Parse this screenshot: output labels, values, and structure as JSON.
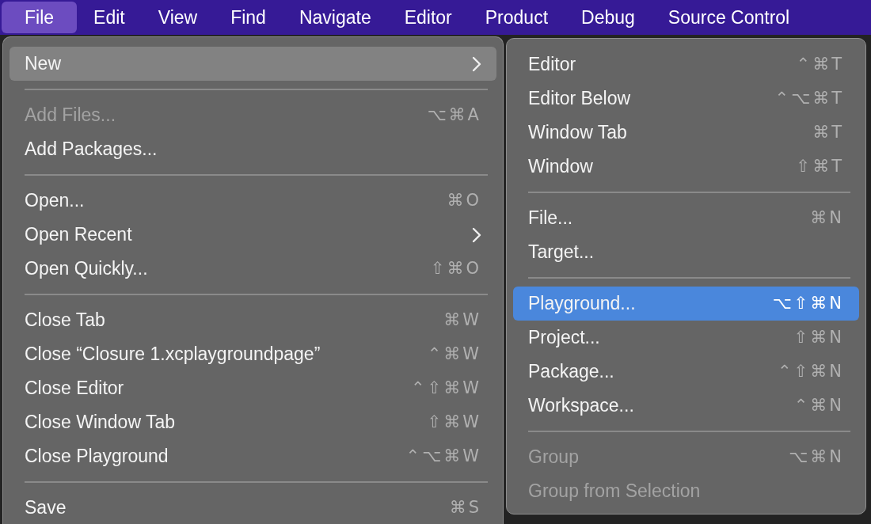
{
  "menu_bar": [
    {
      "label": "File",
      "selected": true
    },
    {
      "label": "Edit",
      "selected": false
    },
    {
      "label": "View",
      "selected": false
    },
    {
      "label": "Find",
      "selected": false
    },
    {
      "label": "Navigate",
      "selected": false
    },
    {
      "label": "Editor",
      "selected": false
    },
    {
      "label": "Product",
      "selected": false
    },
    {
      "label": "Debug",
      "selected": false
    },
    {
      "label": "Source Control",
      "selected": false
    }
  ],
  "file_menu": [
    {
      "kind": "item",
      "label": "New",
      "submenu": true,
      "selected": true,
      "disabled": false
    },
    {
      "kind": "separator"
    },
    {
      "kind": "item",
      "label": "Add Files...",
      "shortcut": "⌥⌘A",
      "selected": false,
      "disabled": true
    },
    {
      "kind": "item",
      "label": "Add Packages...",
      "selected": false,
      "disabled": false
    },
    {
      "kind": "separator"
    },
    {
      "kind": "item",
      "label": "Open...",
      "shortcut": "⌘O",
      "selected": false,
      "disabled": false
    },
    {
      "kind": "item",
      "label": "Open Recent",
      "submenu": true,
      "selected": false,
      "disabled": false
    },
    {
      "kind": "item",
      "label": "Open Quickly...",
      "shortcut": "⇧⌘O",
      "selected": false,
      "disabled": false
    },
    {
      "kind": "separator"
    },
    {
      "kind": "item",
      "label": "Close Tab",
      "shortcut": "⌘W",
      "selected": false,
      "disabled": false
    },
    {
      "kind": "item",
      "label": "Close “Closure 1.xcplaygroundpage”",
      "shortcut": "⌃⌘W",
      "selected": false,
      "disabled": false
    },
    {
      "kind": "item",
      "label": "Close Editor",
      "shortcut": "⌃⇧⌘W",
      "selected": false,
      "disabled": false
    },
    {
      "kind": "item",
      "label": "Close Window Tab",
      "shortcut": "⇧⌘W",
      "selected": false,
      "disabled": false
    },
    {
      "kind": "item",
      "label": "Close Playground",
      "shortcut": "⌃⌥⌘W",
      "selected": false,
      "disabled": false
    },
    {
      "kind": "separator"
    },
    {
      "kind": "item",
      "label": "Save",
      "shortcut": "⌘S",
      "selected": false,
      "disabled": false
    }
  ],
  "new_submenu": [
    {
      "kind": "item",
      "label": "Editor",
      "shortcut": "⌃⌘T",
      "selected": false,
      "disabled": false
    },
    {
      "kind": "item",
      "label": "Editor Below",
      "shortcut": "⌃⌥⌘T",
      "selected": false,
      "disabled": false
    },
    {
      "kind": "item",
      "label": "Window Tab",
      "shortcut": "⌘T",
      "selected": false,
      "disabled": false
    },
    {
      "kind": "item",
      "label": "Window",
      "shortcut": "⇧⌘T",
      "selected": false,
      "disabled": false
    },
    {
      "kind": "separator"
    },
    {
      "kind": "item",
      "label": "File...",
      "shortcut": "⌘N",
      "selected": false,
      "disabled": false
    },
    {
      "kind": "item",
      "label": "Target...",
      "selected": false,
      "disabled": false
    },
    {
      "kind": "separator"
    },
    {
      "kind": "item",
      "label": "Playground...",
      "shortcut": "⌥⇧⌘N",
      "selected": true,
      "disabled": false
    },
    {
      "kind": "item",
      "label": "Project...",
      "shortcut": "⇧⌘N",
      "selected": false,
      "disabled": false
    },
    {
      "kind": "item",
      "label": "Package...",
      "shortcut": "⌃⇧⌘N",
      "selected": false,
      "disabled": false
    },
    {
      "kind": "item",
      "label": "Workspace...",
      "shortcut": "⌃⌘N",
      "selected": false,
      "disabled": false
    },
    {
      "kind": "separator"
    },
    {
      "kind": "item",
      "label": "Group",
      "shortcut": "⌥⌘N",
      "selected": false,
      "disabled": true
    },
    {
      "kind": "item",
      "label": "Group from Selection",
      "selected": false,
      "disabled": true
    }
  ]
}
